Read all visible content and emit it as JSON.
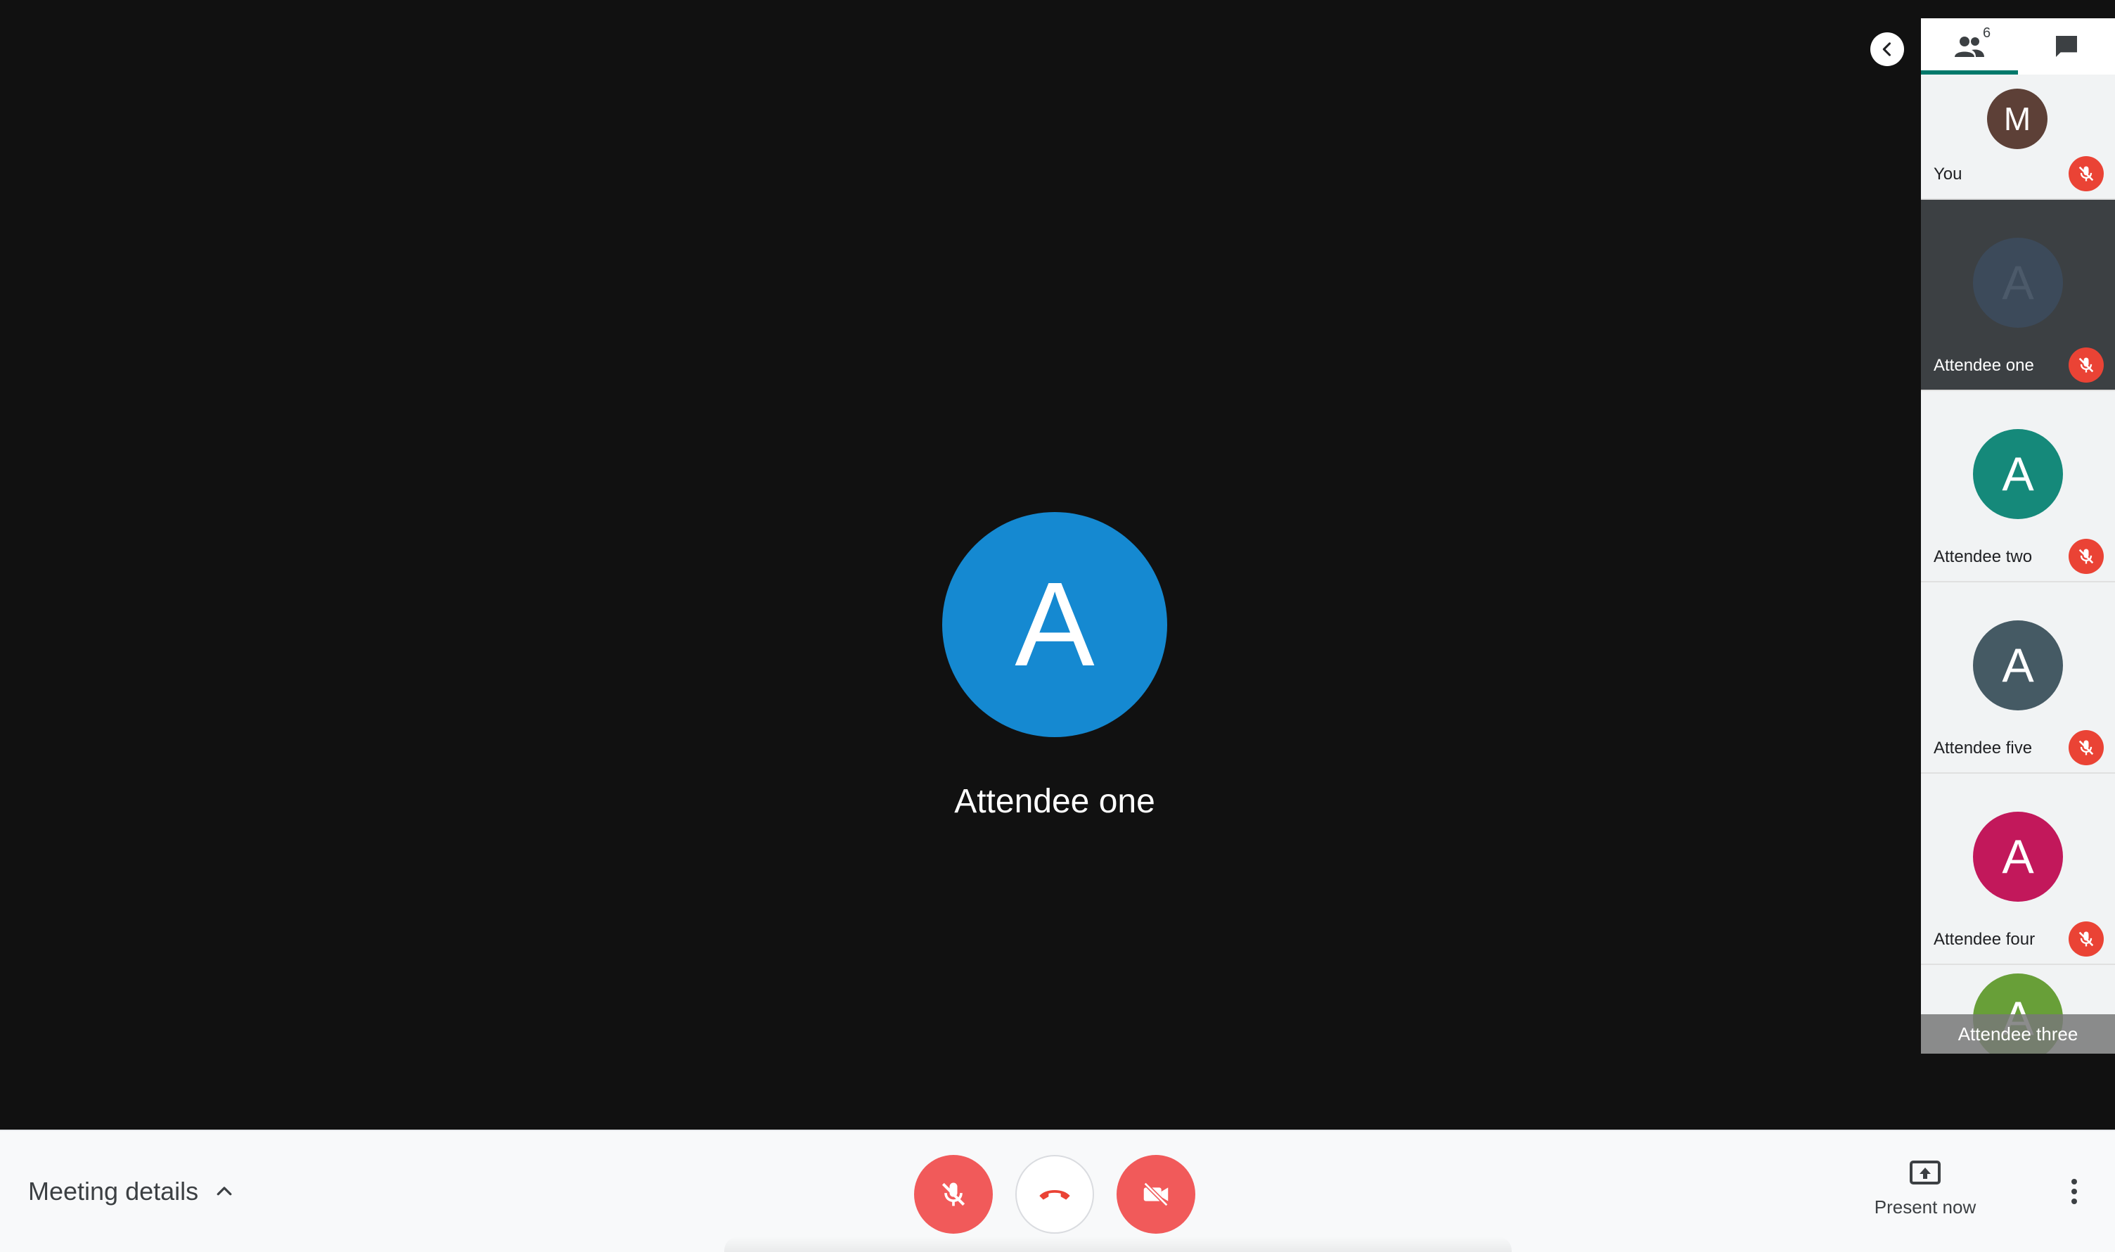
{
  "main": {
    "speaker_initial": "A",
    "speaker_name": "Attendee one",
    "speaker_color": "#1589d1"
  },
  "panel": {
    "people_count": "6",
    "people_tab_icon": "people-icon",
    "chat_tab_icon": "chat-icon",
    "collapse_icon": "chevron-left-icon",
    "participants": [
      {
        "initial": "M",
        "name": "You",
        "color": "#5d4037",
        "muted": true,
        "active": false
      },
      {
        "initial": "A",
        "name": "Attendee one",
        "color": "#3c4a5a",
        "muted": true,
        "active": true
      },
      {
        "initial": "A",
        "name": "Attendee two",
        "color": "#15897a",
        "muted": true,
        "active": false
      },
      {
        "initial": "A",
        "name": "Attendee five",
        "color": "#455a64",
        "muted": true,
        "active": false
      },
      {
        "initial": "A",
        "name": "Attendee four",
        "color": "#c2185b",
        "muted": true,
        "active": false
      },
      {
        "initial": "A",
        "name": "Attendee three",
        "color": "#689f38",
        "muted": false,
        "active": false
      }
    ]
  },
  "bottombar": {
    "meeting_details_label": "Meeting details",
    "present_label": "Present now",
    "mic_icon": "mic-off-icon",
    "hangup_icon": "hangup-icon",
    "camera_icon": "camera-off-icon",
    "more_icon": "more-vert-icon",
    "accent_red": "#f15a5a"
  }
}
